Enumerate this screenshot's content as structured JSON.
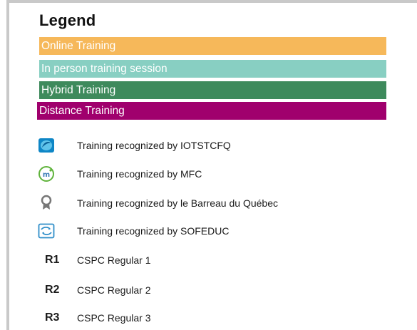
{
  "legend": {
    "title": "Legend",
    "categories": [
      {
        "label": "Online Training",
        "color": "#f6b85a"
      },
      {
        "label": "In person training session",
        "color": "#88cfc2"
      },
      {
        "label": "Hybrid Training",
        "color": "#3e8a5c"
      },
      {
        "label": "Distance Training",
        "color": "#a0006d"
      }
    ],
    "recognitions": [
      {
        "icon": "iotstcfq-logo-icon",
        "label": "Training recognized by IOTSTCFQ"
      },
      {
        "icon": "mfc-logo-icon",
        "label": "Training recognized by MFC"
      },
      {
        "icon": "award-ribbon-icon",
        "label": "Training recognized by le Barreau du Québec"
      },
      {
        "icon": "sofeduc-logo-icon",
        "label": "Training recognized by SOFEDUC"
      }
    ],
    "regulars": [
      {
        "code": "R1",
        "label": "CSPC Regular 1"
      },
      {
        "code": "R2",
        "label": "CSPC Regular 2"
      },
      {
        "code": "R3",
        "label": "CSPC Regular 3"
      }
    ]
  }
}
